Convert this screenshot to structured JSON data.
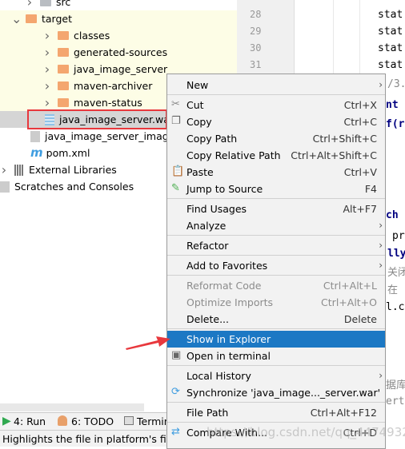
{
  "tree": {
    "items": [
      {
        "label": "src",
        "icon": "folder-gray",
        "chevron": ">"
      },
      {
        "label": "target",
        "icon": "folder",
        "chevron": "v"
      },
      {
        "label": "classes",
        "icon": "folder",
        "chevron": ">"
      },
      {
        "label": "generated-sources",
        "icon": "folder",
        "chevron": ">"
      },
      {
        "label": "java_image_server",
        "icon": "folder",
        "chevron": ">"
      },
      {
        "label": "maven-archiver",
        "icon": "folder",
        "chevron": ">"
      },
      {
        "label": "maven-status",
        "icon": "folder",
        "chevron": ">"
      },
      {
        "label": "java_image_server.war",
        "icon": "archive-icon",
        "selected": true
      },
      {
        "label": "java_image_server_image.i",
        "icon": "file-icon"
      },
      {
        "label": "pom.xml",
        "icon": "maven-icon"
      },
      {
        "label": "External Libraries",
        "icon": "library-icon",
        "chevron": ">"
      },
      {
        "label": "Scratches and Consoles",
        "icon": "scratches-icon"
      }
    ]
  },
  "editor": {
    "line_numbers": [
      "28",
      "29",
      "30",
      "31"
    ],
    "code": [
      "stat",
      "stat",
      "stat",
      "stat",
      "/3.",
      "nt",
      "f(r",
      "",
      "ch",
      "pri",
      "lly",
      "关闭",
      "在",
      "l.c",
      "",
      "据库",
      "ert()"
    ]
  },
  "menu": {
    "items": [
      {
        "label": "New",
        "arrow": true
      },
      {
        "sep": true
      },
      {
        "label": "Cut",
        "shortcut": "Ctrl+X",
        "icon": "scissors-icon"
      },
      {
        "label": "Copy",
        "shortcut": "Ctrl+C",
        "icon": "copy-icon"
      },
      {
        "label": "Copy Path",
        "shortcut": "Ctrl+Shift+C"
      },
      {
        "label": "Copy Relative Path",
        "shortcut": "Ctrl+Alt+Shift+C"
      },
      {
        "label": "Paste",
        "shortcut": "Ctrl+V",
        "icon": "paste-icon"
      },
      {
        "label": "Jump to Source",
        "shortcut": "F4",
        "icon": "jump-icon"
      },
      {
        "sep": true
      },
      {
        "label": "Find Usages",
        "shortcut": "Alt+F7"
      },
      {
        "label": "Analyze",
        "arrow": true
      },
      {
        "sep": true
      },
      {
        "label": "Refactor",
        "arrow": true
      },
      {
        "sep": true
      },
      {
        "label": "Add to Favorites",
        "arrow": true
      },
      {
        "sep": true
      },
      {
        "label": "Reformat Code",
        "shortcut": "Ctrl+Alt+L",
        "disabled": true
      },
      {
        "label": "Optimize Imports",
        "shortcut": "Ctrl+Alt+O",
        "disabled": true
      },
      {
        "label": "Delete...",
        "shortcut": "Delete"
      },
      {
        "sep": true
      },
      {
        "label": "Show in Explorer",
        "highlighted": true
      },
      {
        "label": "Open in terminal",
        "icon": "terminal-icon"
      },
      {
        "sep": true
      },
      {
        "label": "Local History",
        "arrow": true
      },
      {
        "label": "Synchronize 'java_image..._server.war'",
        "icon": "sync-icon"
      },
      {
        "sep": true
      },
      {
        "label": "File Path",
        "shortcut": "Ctrl+Alt+F12"
      },
      {
        "sep": true
      },
      {
        "label": "Compare With...",
        "shortcut": "Ctrl+D",
        "icon": "compare-icon"
      }
    ]
  },
  "toolbar": {
    "run": "4: Run",
    "todo": "6: TODO",
    "terminal": "Termin"
  },
  "status": "Highlights the file in platform's file manager",
  "watermark": "https://blog.csdn.net/qq_44749329",
  "colors": {
    "highlight": "#1c78c4",
    "folder": "#f4a66f",
    "annotation": "#e8383d"
  }
}
